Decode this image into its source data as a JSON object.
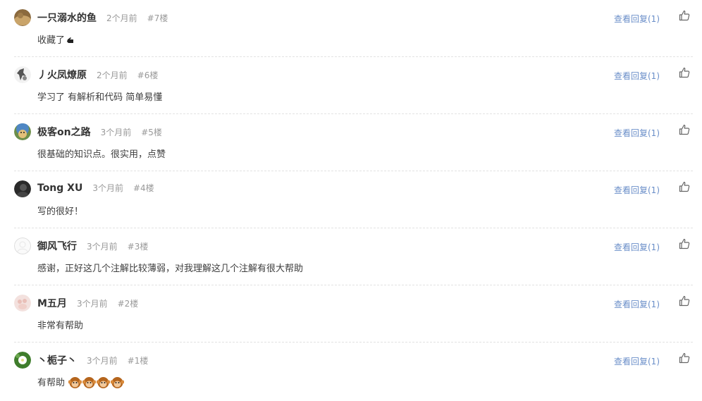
{
  "reply_label": "查看回复(1)",
  "comments": [
    {
      "name": "一只溺水的鱼",
      "time": "2个月前",
      "floor": "#7楼",
      "content": "收藏了",
      "avatar": "avatar-brown"
    },
    {
      "name": "丿火凤燎原",
      "time": "2个月前",
      "floor": "#6楼",
      "content": "学习了 有解析和代码 简单易懂",
      "avatar": "avatar-figure"
    },
    {
      "name": "极客on之路",
      "time": "3个月前",
      "floor": "#5楼",
      "content": "很基础的知识点。很实用，点赞",
      "avatar": "avatar-dog"
    },
    {
      "name": "Tong XU",
      "time": "3个月前",
      "floor": "#4楼",
      "content": "写的很好！",
      "avatar": "avatar-dark"
    },
    {
      "name": "御风飞行",
      "time": "3个月前",
      "floor": "#3楼",
      "content": "感谢，正好这几个注解比较薄弱，对我理解这几个注解有很大帮助",
      "avatar": "avatar-blank"
    },
    {
      "name": "M五月",
      "time": "3个月前",
      "floor": "#2楼",
      "content": "非常有帮助",
      "avatar": "avatar-pink"
    },
    {
      "name": "丶栀子丶",
      "time": "3个月前",
      "floor": "#1楼",
      "content": "有帮助",
      "avatar": "avatar-flower"
    }
  ],
  "colors": {
    "link": "#6b8fc9",
    "meta": "#999999",
    "name": "#333333",
    "divider": "#e2e2e2"
  }
}
